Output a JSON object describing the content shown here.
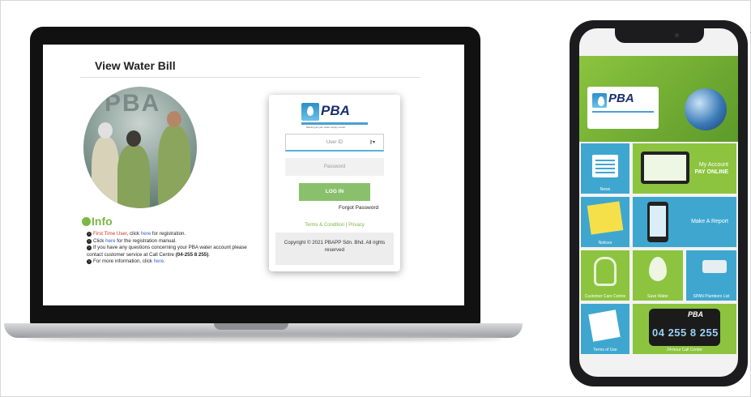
{
  "laptop": {
    "page_title": "View Water Bill",
    "photo_sign": "PBA",
    "info": {
      "heading": "Info",
      "line1_pre": "First Time User",
      "line1_mid": ", click ",
      "line1_link": "here",
      "line1_post": " for registration.",
      "line2_pre": "Click ",
      "line2_link": "here",
      "line2_post": " for the registration manual.",
      "line3": "If you have any questions concerning your PBA water account please contact customer service at Call Centre ",
      "line3_phone": "(04-255 8 255)",
      "line3_end": ".",
      "line4_pre": "For more information, click ",
      "line4_link": "here",
      "line4_end": "."
    },
    "login": {
      "logo_text": "PBA",
      "logo_tagline": "Meeting all your water supply needs",
      "user_id_placeholder": "User ID",
      "password_placeholder": "Password",
      "login_button": "LOG IN",
      "forgot_password": "Forgot Password",
      "terms_link": "Terms & Condition",
      "terms_separator": "|",
      "privacy_link": "Privacy",
      "copyright": "Copyright © 2021 PBAPP Sdn. Bhd. All rights reserved"
    }
  },
  "phone_app": {
    "logo_text": "PBA",
    "tiles": {
      "news": "News",
      "my_account": "My Account",
      "pay_online": "PAY ONLINE",
      "notices": "Notices",
      "make_report": "Make A Report",
      "customer_care": "Customer Care Centre",
      "save_water": "Save Water",
      "plumbers": "SPAN Plumbers List",
      "terms": "Terms of Use",
      "call_centre": "24-hour Call Centre",
      "call_number": "04 255 8 255",
      "call_pba": "PBA"
    }
  },
  "colors": {
    "brand_green": "#8cc43f",
    "brand_blue": "#3fa7cf",
    "login_button": "#8ac06b",
    "logo_navy": "#1d2f6f",
    "info_green": "#7bb845",
    "link_blue": "#2b63c6",
    "alert_red": "#d0342c"
  },
  "icons": [
    "key-icon",
    "arrow-circle-icon",
    "globe-icon",
    "news-icon",
    "tablet-icon",
    "note-icon",
    "phone-icon",
    "hand-icon",
    "drop-icon",
    "tap-icon",
    "pen-icon"
  ]
}
